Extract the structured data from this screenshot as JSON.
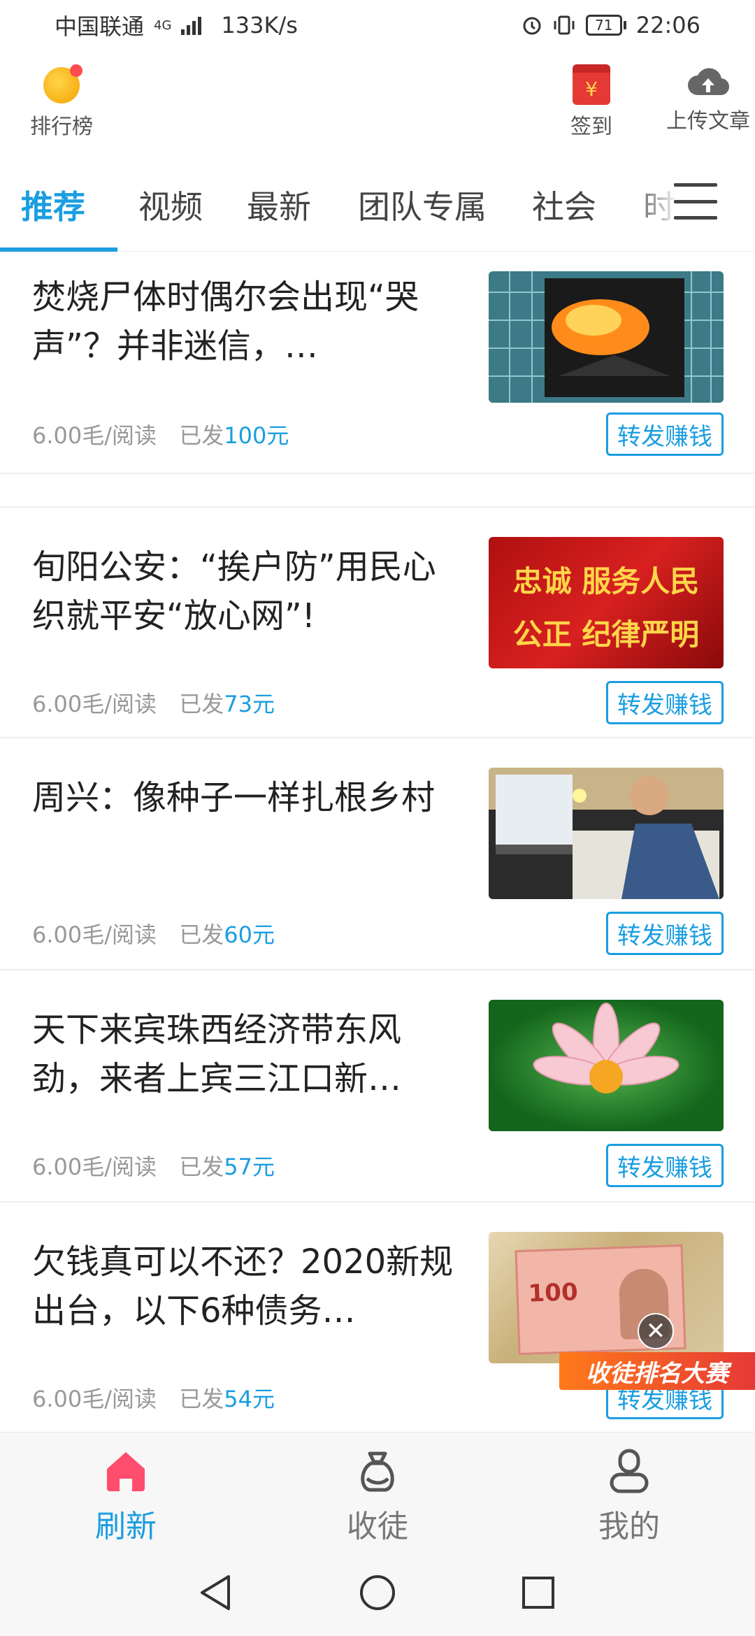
{
  "status_bar": {
    "carrier": "中国联通",
    "network_type": "4G",
    "speed": "133K/s",
    "battery": "71",
    "time": "22:06"
  },
  "top_bar": {
    "ranking_label": "排行榜",
    "signin_label": "签到",
    "upload_label": "上传文章"
  },
  "tabs": [
    {
      "label": "推荐",
      "active": true
    },
    {
      "label": "视频",
      "active": false
    },
    {
      "label": "最新",
      "active": false
    },
    {
      "label": "团队专属",
      "active": false
    },
    {
      "label": "社会",
      "active": false
    },
    {
      "label": "时",
      "active": false
    }
  ],
  "articles": [
    {
      "title": "焚烧尸体时偶尔会出现“哭声”？并非迷信，…",
      "rate": "6.00毛/阅读",
      "earned_prefix": "已发",
      "earned_amount": "100元",
      "share_label": "转发赚钱"
    },
    {
      "title": "旬阳公安：“挨户防”用民心织就平安“放心网”!",
      "rate": "6.00毛/阅读",
      "earned_prefix": "已发",
      "earned_amount": "73元",
      "share_label": "转发赚钱",
      "thumb_text_1": "忠诚 服务人民",
      "thumb_text_2": "公正 纪律严明"
    },
    {
      "title": "周兴：像种子一样扎根乡村",
      "rate": "6.00毛/阅读",
      "earned_prefix": "已发",
      "earned_amount": "60元",
      "share_label": "转发赚钱"
    },
    {
      "title": "天下来宾珠西经济带东风劲，来者上宾三江口新…",
      "rate": "6.00毛/阅读",
      "earned_prefix": "已发",
      "earned_amount": "57元",
      "share_label": "转发赚钱"
    },
    {
      "title": "欠钱真可以不还？2020新规出台，以下6种债务…",
      "rate": "6.00毛/阅读",
      "earned_prefix": "已发",
      "earned_amount": "54元",
      "share_label": "转发赚钱",
      "thumb_text": "100"
    }
  ],
  "promo": {
    "label": "收徒排名大赛",
    "close": "✕"
  },
  "bottom_nav": [
    {
      "label": "刷新",
      "icon": "home-icon",
      "active": true
    },
    {
      "label": "收徒",
      "icon": "bag-icon",
      "active": false
    },
    {
      "label": "我的",
      "icon": "profile-icon",
      "active": false
    }
  ],
  "colors": {
    "accent": "#1a9ee0",
    "active_home": "#ff4d6d",
    "promo": "#e53935"
  }
}
